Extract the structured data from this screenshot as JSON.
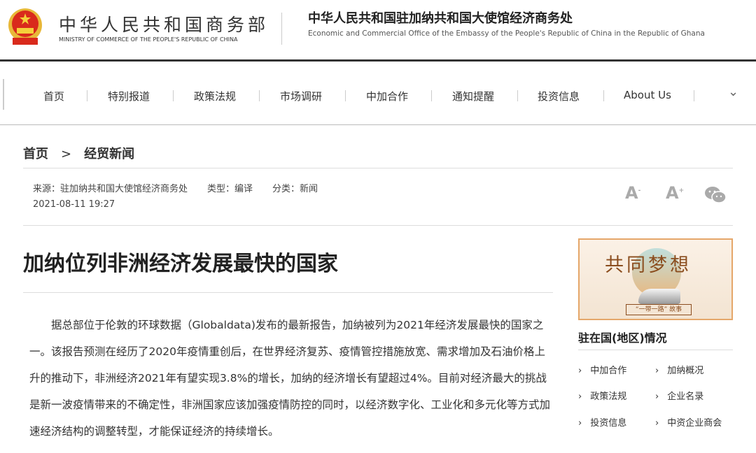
{
  "header": {
    "ministry_cn": "中华人民共和国商务部",
    "ministry_en": "MINISTRY OF COMMERCE OF THE PEOPLE'S REPUBLIC OF CHINA",
    "office_cn": "中华人民共和国驻加纳共和国大使馆经济商务处",
    "office_en": "Economic and Commercial Office of the Embassy of the People's Republic of China in the Republic of Ghana"
  },
  "nav": [
    "首页",
    "特别报道",
    "政策法规",
    "市场调研",
    "中加合作",
    "通知提醒",
    "投资信息",
    "About Us"
  ],
  "breadcrumb": {
    "home": "首页",
    "sep": ">",
    "current": "经贸新闻"
  },
  "meta": {
    "source": "来源：驻加纳共和国大使馆经济商务处",
    "type": "类型：编译",
    "category": "分类：新闻",
    "date": "2021-08-11 19:27"
  },
  "tools": {
    "decrease": "A",
    "decrease_sup": "-",
    "increase": "A",
    "increase_sup": "+"
  },
  "article": {
    "title": "加纳位列非洲经济发展最快的国家",
    "body": "据总部位于伦敦的环球数据（Globaldata)发布的最新报告，加纳被列为2021年经济发展最快的国家之一。该报告预测在经历了2020年疫情重创后，在世界经济复苏、疫情管控措施放宽、需求增加及石油价格上升的推动下，非洲经济2021年有望实现3.8%的增长，加纳的经济增长有望超过4%。目前对经济最大的挑战是新一波疫情带来的不确定性，非洲国家应该加强疫情防控的同时，以经济数字化、工业化和多元化等方式加速经济结构的调整转型，才能保证经济的持续增长。"
  },
  "sidebar": {
    "banner_title": "共同梦想",
    "banner_tag": "“一带一路” 故事",
    "heading": "驻在国(地区)情况",
    "links": [
      "中加合作",
      "加纳概况",
      "政策法规",
      "企业名录",
      "投资信息",
      "中资企业商会"
    ]
  }
}
